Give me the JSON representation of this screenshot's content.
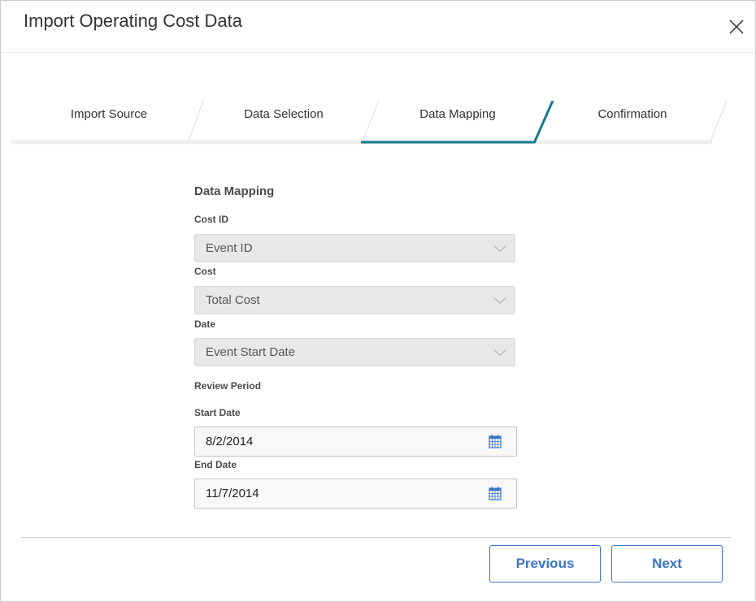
{
  "dialog": {
    "title": "Import Operating Cost Data"
  },
  "steps": [
    {
      "label": "Import Source",
      "active": false
    },
    {
      "label": "Data Selection",
      "active": false
    },
    {
      "label": "Data Mapping",
      "active": true
    },
    {
      "label": "Confirmation",
      "active": false
    }
  ],
  "colors": {
    "active_step": "#1a7a8c",
    "button": "#3b74c9",
    "select_bg": "#e8e8e8"
  },
  "form": {
    "section_title": "Data Mapping",
    "cost_id": {
      "label": "Cost ID",
      "value": "Event ID"
    },
    "cost": {
      "label": "Cost",
      "value": "Total Cost"
    },
    "date": {
      "label": "Date",
      "value": "Event Start Date"
    },
    "review_period_label": "Review Period",
    "start_date": {
      "label": "Start Date",
      "value": "8/2/2014"
    },
    "end_date": {
      "label": "End Date",
      "value": "11/7/2014"
    }
  },
  "footer": {
    "previous_label": "Previous",
    "next_label": "Next"
  },
  "icons": {
    "close": "close-icon",
    "chevron": "chevron-down-icon",
    "calendar": "calendar-icon"
  }
}
